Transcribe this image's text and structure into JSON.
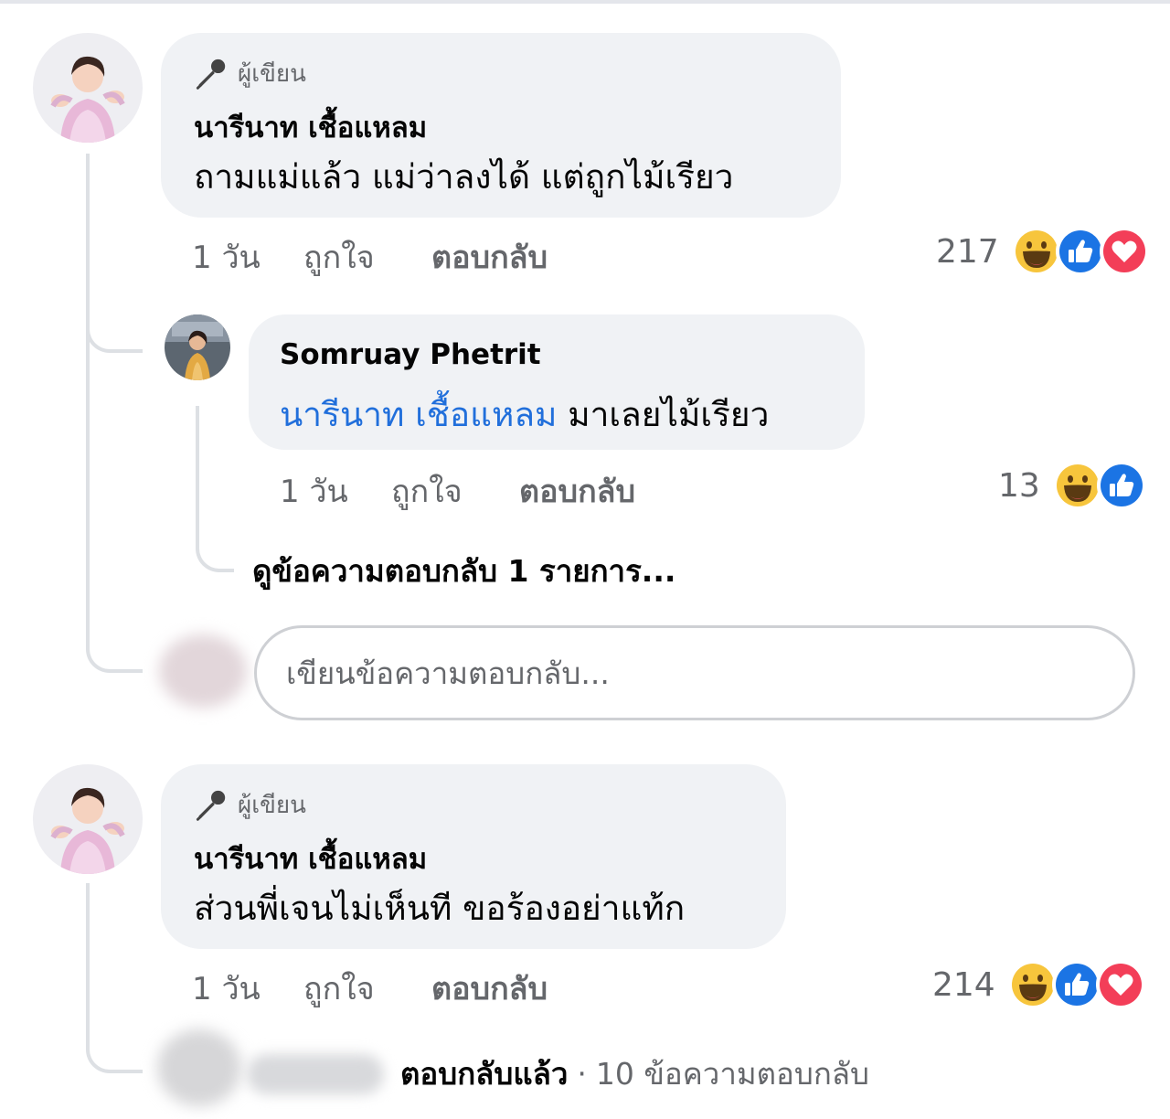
{
  "colors": {
    "bubble": "#f0f2f5",
    "mention": "#216fdb",
    "meta": "#65676b",
    "line": "#dde0e4"
  },
  "comments": [
    {
      "author_badge": "ผู้เขียน",
      "badge_icon": "microphone-icon",
      "name": "นารีนาท เชื้อแหลม",
      "text": "ถามแม่แล้ว แม่ว่าลงได้ แต่ถูกไม้เรียว",
      "time": "1 วัน",
      "like_label": "ถูกใจ",
      "reply_label": "ตอบกลับ",
      "reaction_count": "217",
      "reactions": [
        "haha-emoji",
        "like-emoji",
        "love-emoji"
      ]
    },
    {
      "author_badge": "ผู้เขียน",
      "badge_icon": "microphone-icon",
      "name": "นารีนาท เชื้อแหลม",
      "text": "ส่วนพี่เจนไม่เห็นที ขอร้องอย่าแท้ก",
      "time": "1 วัน",
      "like_label": "ถูกใจ",
      "reply_label": "ตอบกลับ",
      "reaction_count": "214",
      "reactions": [
        "haha-emoji",
        "like-emoji",
        "love-emoji"
      ]
    }
  ],
  "reply": {
    "name": "Somruay Phetrit",
    "mention": "นารีนาท เชื้อแหลม",
    "text": "มาเลยไม้เรียว",
    "time": "1 วัน",
    "like_label": "ถูกใจ",
    "reply_label": "ตอบกลับ",
    "reaction_count": "13",
    "reactions": [
      "haha-emoji",
      "like-emoji"
    ]
  },
  "view_more_replies": "ดูข้อความตอบกลับ 1 รายการ...",
  "reply_input": {
    "placeholder": "เขียนข้อความตอบกลับ..."
  },
  "replied_summary": {
    "verb": "ตอบกลับแล้ว",
    "separator": "·",
    "count_text": "10 ข้อความตอบกลับ"
  }
}
